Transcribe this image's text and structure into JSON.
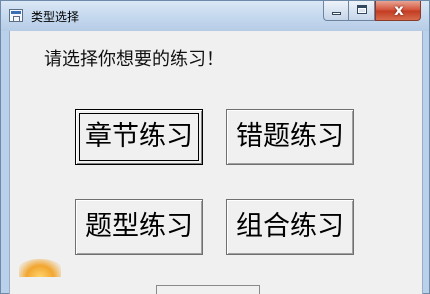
{
  "window": {
    "title": "类型选择",
    "controls": {
      "minimize_icon": "minimize-icon",
      "maximize_icon": "maximize-icon",
      "close_icon": "close-icon",
      "close_glyph": "x"
    }
  },
  "main": {
    "prompt": "请选择你想要的练习！",
    "buttons": {
      "chapter": "章节练习",
      "mistakes": "错题练习",
      "question_type": "题型练习",
      "combined": "组合练习"
    }
  },
  "colors": {
    "titlebar": "#c6d9ee",
    "client_background": "#f0f0f0",
    "close_button": "#c23b22"
  }
}
